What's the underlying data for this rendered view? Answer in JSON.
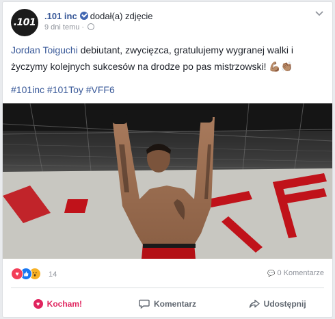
{
  "post": {
    "page_name": ".101 inc",
    "avatar_text": ".101",
    "action_text": "dodał(a) zdjęcie",
    "time": "9 dni temu",
    "mention": "Jordan Toiguchi",
    "text": " debiutant, zwycięzca, gratulujemy wygranej walki i życzymy kolejnych sukcesów na drodze po pas mistrzowski! ",
    "emoji_1": "💪🏽",
    "emoji_2": "👏🏽",
    "hashtags": "#101inc #101Toy #VFF6"
  },
  "reactions": {
    "count": "14",
    "comments": "0 Komentarze",
    "icons": [
      "love-icon",
      "like-icon",
      "wow-icon"
    ],
    "colors": {
      "love": "#f33e58",
      "like": "#1877f2",
      "wow": "#f7b125"
    }
  },
  "actions": {
    "love_label": "Kocham!",
    "comment_label": "Komentarz",
    "share_label": "Udostępnij"
  },
  "colors": {
    "link": "#385898",
    "text": "#1d2129",
    "muted": "#90949c",
    "love": "#e0245e"
  }
}
